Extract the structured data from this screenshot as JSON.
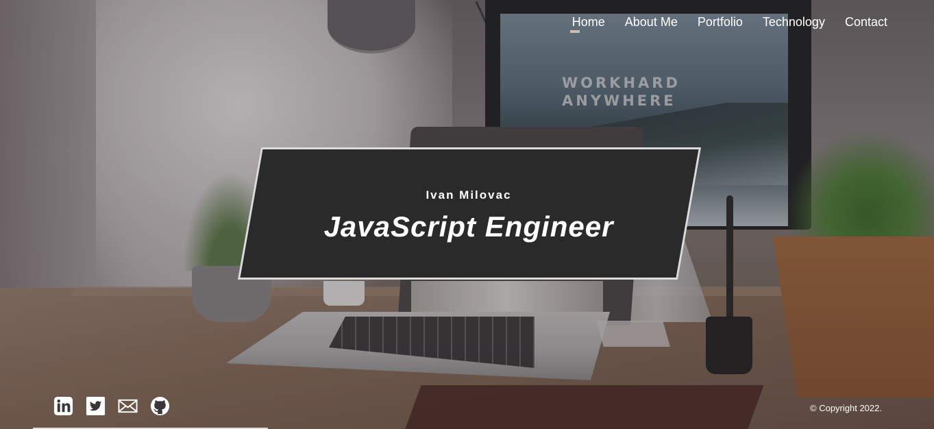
{
  "nav": {
    "items": [
      {
        "label": "Home",
        "active": true
      },
      {
        "label": "About Me",
        "active": false
      },
      {
        "label": "Portfolio",
        "active": false
      },
      {
        "label": "Technology",
        "active": false
      },
      {
        "label": "Contact",
        "active": false
      }
    ]
  },
  "hero": {
    "name": "Ivan Milovac",
    "title": "JavaScript Engineer",
    "screen_text_line1": "WORKHARD",
    "screen_text_line2": "ANYWHERE"
  },
  "social": [
    {
      "icon": "linkedin-icon"
    },
    {
      "icon": "twitter-icon"
    },
    {
      "icon": "mail-icon"
    },
    {
      "icon": "github-icon"
    }
  ],
  "footer": {
    "copyright": "© Copyright 2022."
  },
  "colors": {
    "banner_bg": "#2a2a2a",
    "banner_border": "#dcdcdc",
    "nav_text": "#ffffff",
    "active_indicator": "#c9bfb4"
  }
}
